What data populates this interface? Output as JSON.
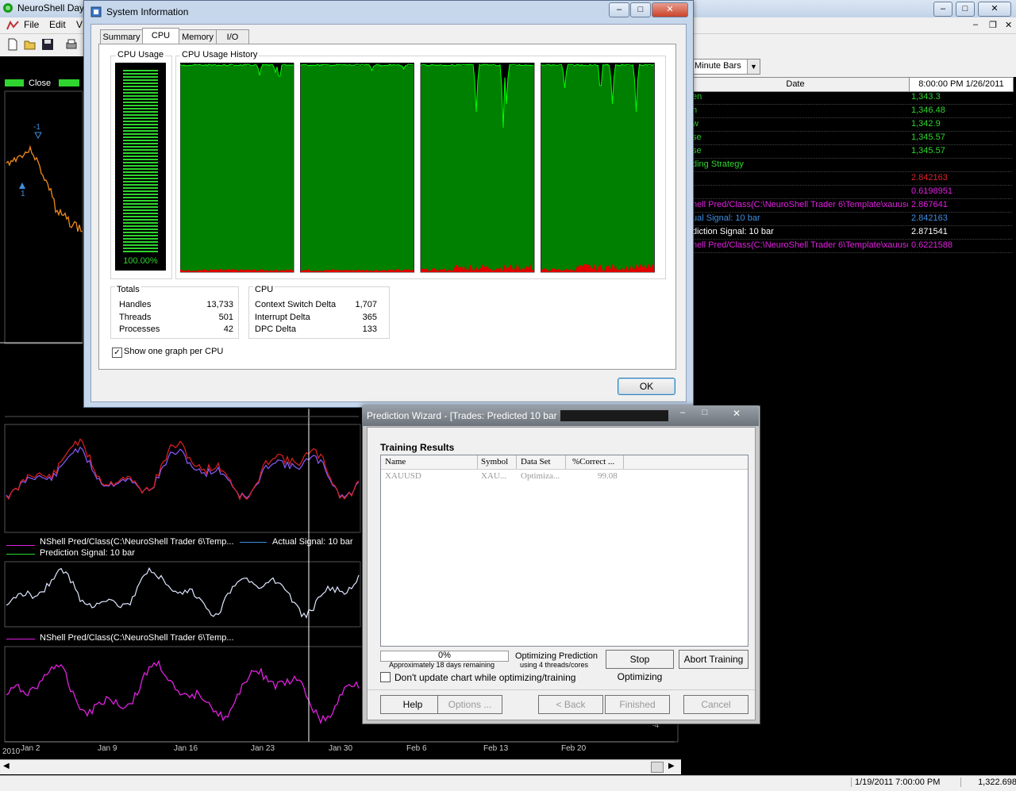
{
  "app": {
    "title": "NeuroShell Day",
    "menu": [
      "File",
      "Edit",
      "V"
    ],
    "bar_select": "Minute Bars"
  },
  "chart": {
    "close_label": "Close",
    "legend1_a": "NShell Pred/Class(C:\\NeuroShell Trader 6\\Temp...",
    "legend1_b": "Actual Signal: 10 bar",
    "legend1_c": "Prediction Signal: 10 bar",
    "legend2_a": "NShell Pred/Class(C:\\NeuroShell Trader 6\\Temp...",
    "marker1": "-1",
    "marker2": "1",
    "x_ticks": [
      "Jan 2",
      "Jan 9",
      "Jan 16",
      "Jan 23",
      "Jan 30",
      "Feb 6",
      "Feb 13",
      "Feb 20"
    ],
    "year": "2010",
    "y_tick_small": "-4"
  },
  "grid": {
    "header_date": "Date",
    "header_value": "8:00:00 PM 1/26/2011",
    "rows": [
      {
        "name": "en",
        "value": "1,343.3",
        "color": "#2fd62f"
      },
      {
        "name": "h",
        "value": "1,346.48",
        "color": "#2fd62f"
      },
      {
        "name": "w",
        "value": "1,342.9",
        "color": "#2fd62f"
      },
      {
        "name": "se",
        "value": "1,345.57",
        "color": "#2fd62f"
      },
      {
        "name": "se",
        "value": "1,345.57",
        "color": "#2fd62f"
      },
      {
        "name": "ding Strategy",
        "value": "",
        "color": "#2fd62f"
      },
      {
        "name": "",
        "value": "2.842163",
        "color": "#e0202a"
      },
      {
        "name": "",
        "value": "0.6198951",
        "color": "#e020e0"
      },
      {
        "name": "hell Pred/Class(C:\\NeuroShell Trader 6\\Template\\xauusd",
        "value": "2.867641",
        "color": "#e020e0"
      },
      {
        "name": "ual Signal: 10 bar",
        "value": "2.842163",
        "color": "#3d8ee0"
      },
      {
        "name": "diction Signal: 10 bar",
        "value": "2.871541",
        "color": "#ffffff"
      },
      {
        "name": "hell Pred/Class(C:\\NeuroShell Trader 6\\Template\\xauusd",
        "value": "0.6221588",
        "color": "#e020e0"
      }
    ]
  },
  "status": {
    "datetime": "1/19/2011 7:00:00 PM",
    "value": "1,322.698"
  },
  "sysinfo": {
    "title": "System Information",
    "tabs": [
      "Summary",
      "CPU",
      "Memory",
      "I/O"
    ],
    "cpu_usage_label": "CPU Usage",
    "cpu_usage_value": "100.00%",
    "cpu_usage_fraction": 1.0,
    "history_label": "CPU Usage History",
    "totals": {
      "label": "Totals",
      "handles_label": "Handles",
      "handles": "13,733",
      "threads_label": "Threads",
      "threads": "501",
      "processes_label": "Processes",
      "processes": "42"
    },
    "cpu": {
      "label": "CPU",
      "ctx_label": "Context Switch Delta",
      "ctx": "1,707",
      "int_label": "Interrupt Delta",
      "int": "365",
      "dpc_label": "DPC Delta",
      "dpc": "133"
    },
    "checkbox_label": "Show one graph per CPU",
    "ok_label": "OK"
  },
  "wizard": {
    "title": "Prediction Wizard - [Trades: Predicted 10 bar",
    "section": "Training Results",
    "columns": [
      "Name",
      "Symbol",
      "Data Set",
      "%Correct ..."
    ],
    "row": [
      "XAUUSD",
      "XAU...",
      "Optimiza...",
      "99.08"
    ],
    "progress_pct": "0%",
    "progress_fraction": 0.0,
    "remaining": "Approximately 18 days remaining",
    "status_title": "Optimizing Prediction",
    "status_sub": "using 4 threads/cores",
    "stop_label": "Stop Optimizing",
    "abort_label": "Abort Training",
    "checkbox_label": "Don't update chart while optimizing/training",
    "buttons": [
      "Help",
      "Options ...",
      "< Back",
      "Finished",
      "Cancel"
    ]
  },
  "colors": {
    "graph_green": "#008000",
    "graph_line": "#00ff00",
    "kernel_red": "#e00000",
    "price_orange": "#f28a1d",
    "red_series": "#e02020",
    "purple_series": "#8a5cff",
    "magenta_series": "#e020e0",
    "white_series": "#dfe8ff"
  },
  "icons": [
    "app-logo-icon",
    "new-icon",
    "open-icon",
    "save-icon",
    "print-icon",
    "window-icon",
    "minimize-icon",
    "maximize-icon",
    "close-icon",
    "dropdown-arrow-icon",
    "checkmark-icon",
    "scroll-arrow-icon"
  ]
}
